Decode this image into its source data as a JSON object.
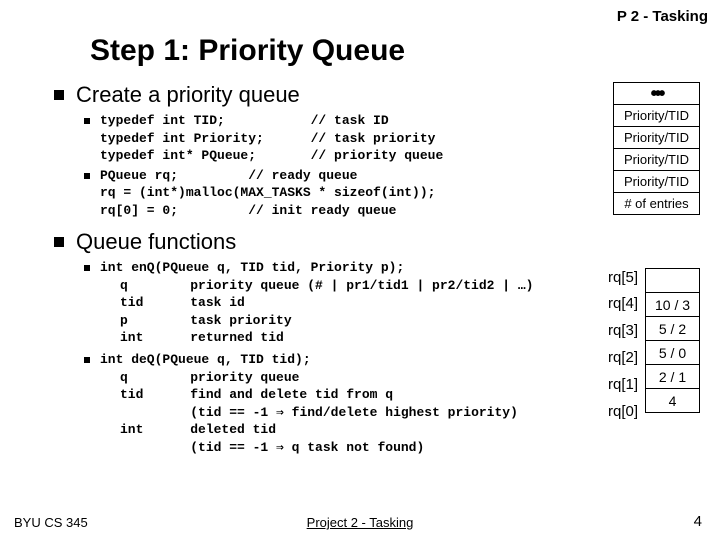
{
  "header_tag": "P 2 - Tasking",
  "title": "Step 1: Priority Queue",
  "section1": "Create a priority queue",
  "code1a": "typedef int TID;           // task ID\ntypedef int Priority;      // task priority\ntypedef int* PQueue;       // priority queue",
  "code1b": "PQueue rq;         // ready queue\nrq = (int*)malloc(MAX_TASKS * sizeof(int));\nrq[0] = 0;         // init ready queue",
  "section2": "Queue functions",
  "code2a": "int enQ(PQueue q, TID tid, Priority p);",
  "code2a_rows": [
    "q        priority queue (# | pr1/tid1 | pr2/tid2 | …)",
    "tid      task id",
    "p        task priority",
    "int      returned tid"
  ],
  "code2b": "int deQ(PQueue q, TID tid);",
  "code2b_rows": [
    "q        priority queue",
    "tid      find and delete tid from q",
    "         (tid == -1 ⇒ find/delete highest priority)",
    "int      deleted tid",
    "         (tid == -1 ⇒ q task not found)"
  ],
  "top_table": [
    "•••",
    "Priority/TID",
    "Priority/TID",
    "Priority/TID",
    "Priority/TID",
    "# of entries"
  ],
  "bottom_labels": [
    "rq[5]",
    "rq[4]",
    "rq[3]",
    "rq[2]",
    "rq[1]",
    "rq[0]"
  ],
  "bottom_table": [
    "",
    "10 / 3",
    "5 / 2",
    "5 / 0",
    "2 / 1",
    "4"
  ],
  "footer_left": "BYU CS 345",
  "footer_center": "Project 2 - Tasking",
  "footer_right": "4"
}
